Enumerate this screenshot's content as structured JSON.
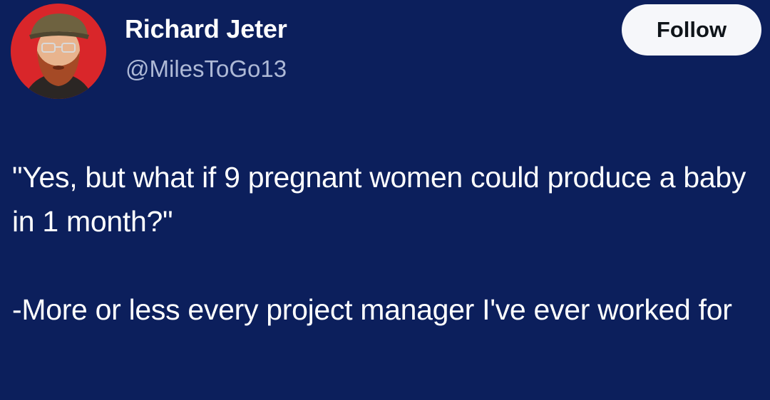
{
  "tweet": {
    "author": {
      "name": "Richard Jeter",
      "handle": "@MilesToGo13"
    },
    "follow_label": "Follow",
    "body": {
      "quote": "\"Yes, but what if 9 pregnant women could produce a baby in 1 month?\"",
      "attribution": "-More or less every project manager I've ever worked for"
    }
  },
  "colors": {
    "background": "#0c1f5c",
    "avatar_ring": "#d9262a",
    "handle_text": "#aeb9d6",
    "follow_button": "#f6f7fa"
  }
}
